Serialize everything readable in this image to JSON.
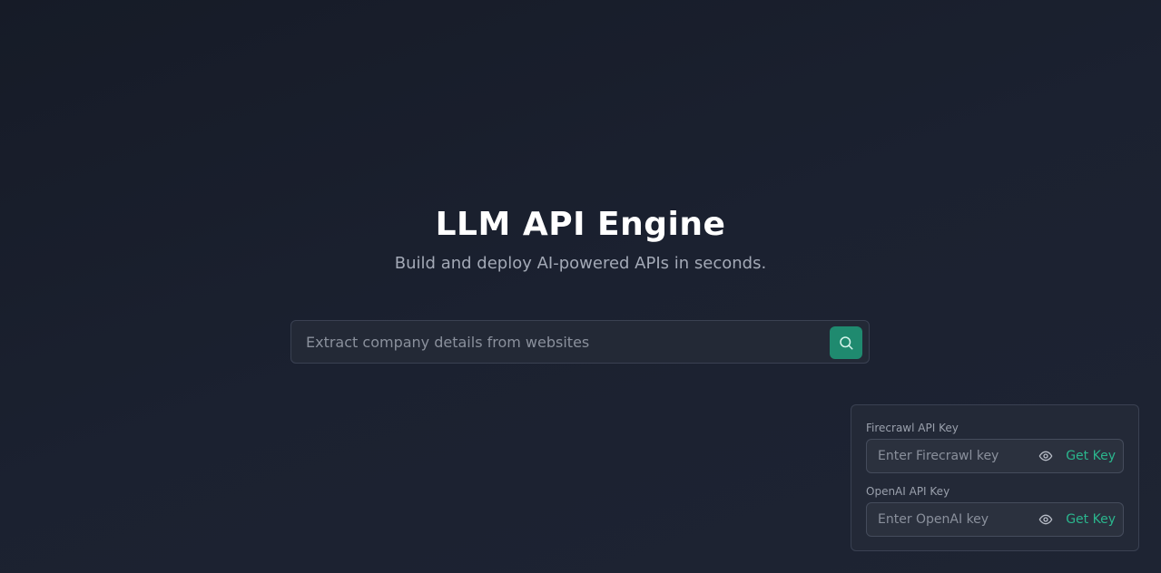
{
  "hero": {
    "title": "LLM API Engine",
    "subtitle": "Build and deploy AI-powered APIs in seconds."
  },
  "search": {
    "placeholder": "Extract company details from websites",
    "button_icon": "search-icon"
  },
  "api_keys": {
    "firecrawl": {
      "label": "Firecrawl API Key",
      "placeholder": "Enter Firecrawl key",
      "toggle_icon": "eye-icon",
      "link_label": "Get Key"
    },
    "openai": {
      "label": "OpenAI API Key",
      "placeholder": "Enter OpenAI key",
      "toggle_icon": "eye-icon",
      "link_label": "Get Key"
    }
  },
  "colors": {
    "accent": "#1f8a6f",
    "link": "#2bb58d",
    "background": "#1b2130"
  }
}
